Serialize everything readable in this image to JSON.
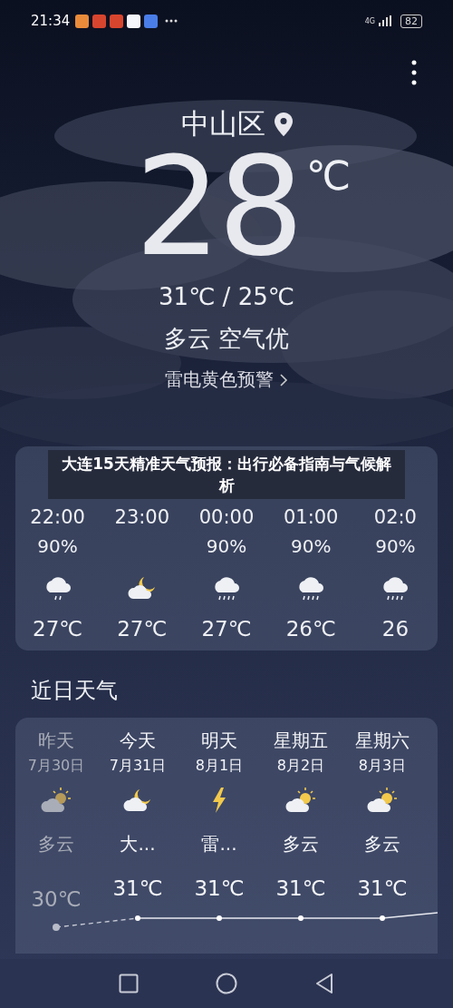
{
  "status_bar": {
    "time": "21:34",
    "network": "4G",
    "battery": "82"
  },
  "location": {
    "city": "中山区"
  },
  "current": {
    "temperature": "28",
    "unit": "℃",
    "range": "31℃ / 25℃",
    "condition": "多云 空气优",
    "alert": "雷电黄色预警"
  },
  "banner": {
    "text": "大连15天精准天气预报：出行必备指南与气候解析"
  },
  "hourly": [
    {
      "time": "22:00",
      "precip": "90%",
      "kind": "light-rain",
      "temperature": "27℃"
    },
    {
      "time": "23:00",
      "kind": "night-cloudy",
      "temperature": "27℃"
    },
    {
      "time": "00:00",
      "precip": "90%",
      "kind": "rain",
      "temperature": "27℃"
    },
    {
      "time": "01:00",
      "precip": "90%",
      "kind": "rain",
      "temperature": "26℃"
    },
    {
      "time": "02:0",
      "precip": "90%",
      "kind": "rain",
      "temperature": "26"
    }
  ],
  "daily_title": "近日天气",
  "daily": [
    {
      "day": "昨天",
      "date": "7月30日",
      "kind": "partly-cloudy",
      "condition": "多云",
      "high": "30℃",
      "past": true
    },
    {
      "day": "今天",
      "date": "7月31日",
      "kind": "night-cloudy",
      "condition": "大...",
      "high": "31℃",
      "past": false
    },
    {
      "day": "明天",
      "date": "8月1日",
      "kind": "thunder",
      "condition": "雷...",
      "high": "31℃",
      "past": false
    },
    {
      "day": "星期五",
      "date": "8月2日",
      "kind": "partly-cloudy",
      "condition": "多云",
      "high": "31℃",
      "past": false
    },
    {
      "day": "星期六",
      "date": "8月3日",
      "kind": "partly-cloudy",
      "condition": "多云",
      "high": "31℃",
      "past": false
    }
  ]
}
